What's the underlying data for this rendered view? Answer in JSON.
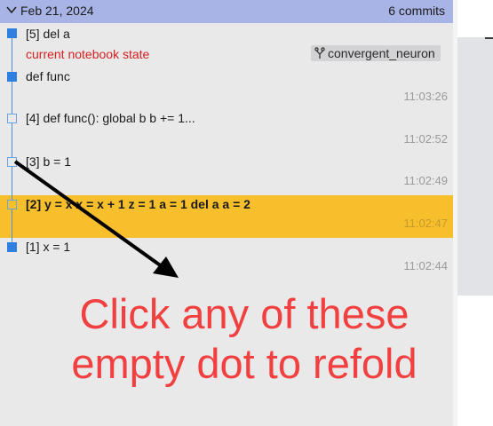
{
  "header": {
    "date": "Feb 21, 2024",
    "commit_count": "6 commits"
  },
  "entries": [
    {
      "label": "[5] del a",
      "time": ""
    },
    {
      "label": "def func",
      "time": "11:03:26"
    },
    {
      "label": "[4] def func(): global b b += 1...",
      "time": "11:02:52"
    },
    {
      "label": "[3] b = 1",
      "time": "11:02:49"
    },
    {
      "label": "[2] y = x x = x + 1 z = 1 a = 1 del a a = 2",
      "time": "11:02:47"
    },
    {
      "label": "[1] x = 1",
      "time": "11:02:44"
    }
  ],
  "status": {
    "text": "current notebook state",
    "color": "#d42020"
  },
  "branch": {
    "name": "convergent_neuron",
    "icon": "branch-icon"
  },
  "highlight_color": "#f8bf2d",
  "overlay": {
    "line1": "Click any of these",
    "line2": "empty dot to refold",
    "color": "#f24040"
  }
}
